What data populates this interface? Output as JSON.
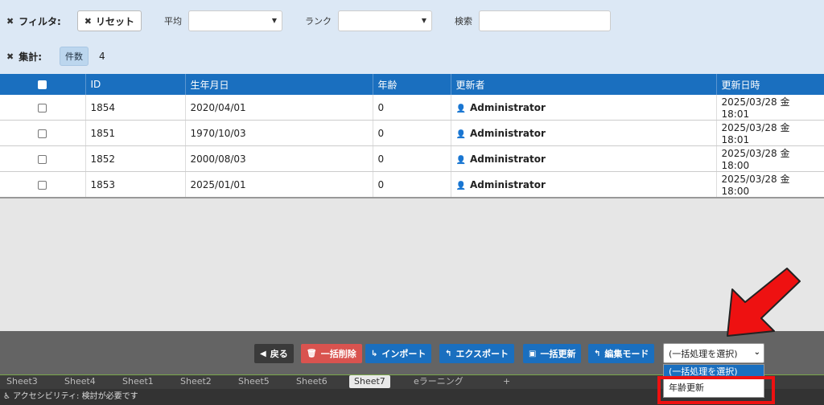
{
  "filter": {
    "filter_label": "フィルタ:",
    "reset_label": "リセット",
    "average_label": "平均",
    "rank_label": "ランク",
    "search_label": "検索",
    "aggregate_label": "集計:",
    "count_badge": "件数",
    "count_value": "4"
  },
  "table": {
    "headers": [
      "ID",
      "生年月日",
      "年齢",
      "更新者",
      "更新日時"
    ],
    "rows": [
      {
        "id": "1854",
        "birth": "2020/04/01",
        "age": "0",
        "user": "Administrator",
        "updated": "2025/03/28 金 18:01"
      },
      {
        "id": "1851",
        "birth": "1970/10/03",
        "age": "0",
        "user": "Administrator",
        "updated": "2025/03/28 金 18:01"
      },
      {
        "id": "1852",
        "birth": "2000/08/03",
        "age": "0",
        "user": "Administrator",
        "updated": "2025/03/28 金 18:00"
      },
      {
        "id": "1853",
        "birth": "2025/01/01",
        "age": "0",
        "user": "Administrator",
        "updated": "2025/03/28 金 18:00"
      }
    ]
  },
  "toolbar": {
    "back": "戻る",
    "bulk_delete": "一括削除",
    "import": "インポート",
    "export": "エクスポート",
    "bulk_update": "一括更新",
    "edit_mode": "編集モード",
    "bulk_select_value": "(一括処理を選択)"
  },
  "dropdown": {
    "options": [
      "(一括処理を選択)",
      "年齢更新"
    ]
  },
  "sheets": [
    "Sheet3",
    "Sheet4",
    "Sheet1",
    "Sheet2",
    "Sheet5",
    "Sheet6",
    "Sheet7",
    "eラーニング",
    "+"
  ],
  "status": "アクセシビリティ: 検討が必要です",
  "colors": {
    "accent": "#1a6fbf",
    "danger": "#d9534f",
    "highlight": "#ee1111"
  }
}
